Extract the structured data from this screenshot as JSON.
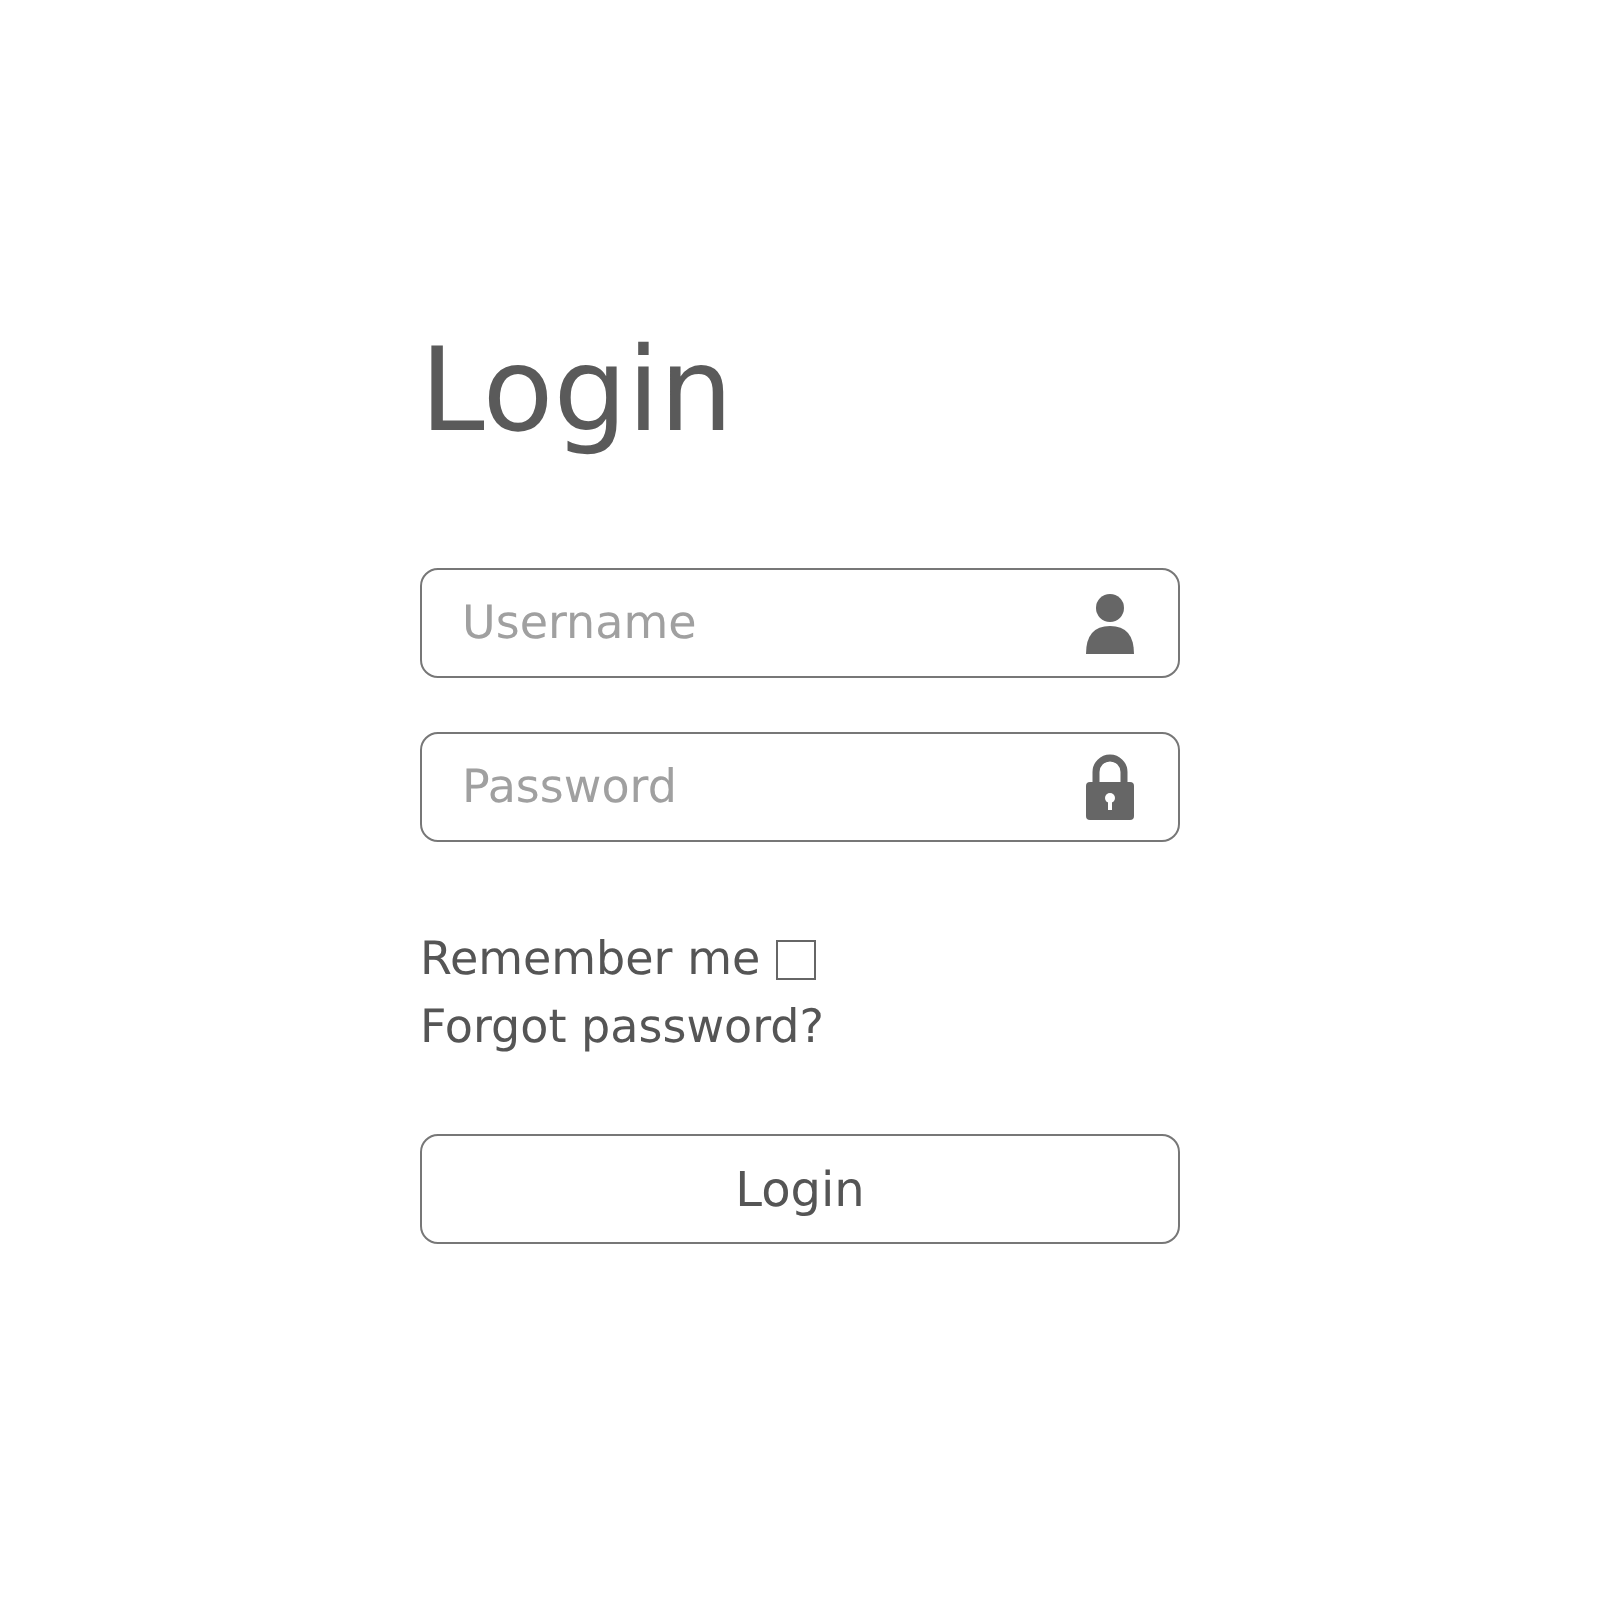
{
  "title": "Login",
  "fields": [
    {
      "placeholder": "Username",
      "kind": "user"
    },
    {
      "placeholder": "Password",
      "kind": "lock"
    }
  ],
  "remember": {
    "label": "Remember me",
    "checked": false
  },
  "forgot": "Forgot password?",
  "button": "Login"
}
